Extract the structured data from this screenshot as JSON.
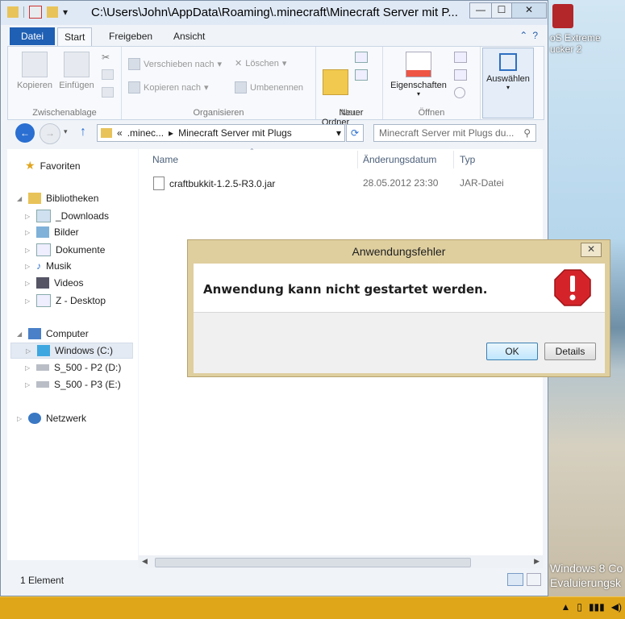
{
  "desktop": {
    "shortcut_label": "oS Extreme\nucker 2",
    "watermark": "Windows 8 Co\nEvaluierungsk"
  },
  "explorer": {
    "title": "C:\\Users\\John\\AppData\\Roaming\\.minecraft\\Minecraft Server mit P...",
    "window_buttons": {
      "minimize": "—",
      "maximize": "☐",
      "close": "✕"
    },
    "tabs": {
      "file": "Datei",
      "start": "Start",
      "share": "Freigeben",
      "view": "Ansicht"
    },
    "ribbon": {
      "clipboard": {
        "copy": "Kopieren",
        "paste": "Einfügen",
        "group": "Zwischenablage"
      },
      "organize": {
        "move_to": "Verschieben nach",
        "copy_to": "Kopieren nach",
        "delete": "Löschen",
        "rename": "Umbenennen",
        "group": "Organisieren"
      },
      "new": {
        "new_folder": "Neuer\nOrdner",
        "group": "Neu"
      },
      "open": {
        "properties": "Eigenschaften",
        "group": "Öffnen"
      },
      "select": {
        "select": "Auswählen"
      }
    },
    "address": {
      "prefix": "«",
      "segment1": ".minec...",
      "separator": "▸",
      "segment2": "Minecraft Server mit Plugs",
      "search_placeholder": "Minecraft Server mit Plugs du..."
    },
    "nav": {
      "favorites": "Favoriten",
      "libraries": "Bibliotheken",
      "downloads": "_Downloads",
      "pictures": "Bilder",
      "documents": "Dokumente",
      "music": "Musik",
      "videos": "Videos",
      "z_desktop": "Z - Desktop",
      "computer": "Computer",
      "drive_c": "Windows (C:)",
      "drive_d": "S_500 - P2 (D:)",
      "drive_e": "S_500 - P3 (E:)",
      "network": "Netzwerk"
    },
    "columns": {
      "name": "Name",
      "modified": "Änderungsdatum",
      "type": "Typ"
    },
    "files": [
      {
        "name": "craftbukkit-1.2.5-R3.0.jar",
        "modified": "28.05.2012 23:30",
        "type": "JAR-Datei"
      }
    ],
    "status": "1 Element"
  },
  "dialog": {
    "title": "Anwendungsfehler",
    "message": "Anwendung kann nicht gestartet werden.",
    "ok": "OK",
    "details": "Details",
    "close": "✕"
  },
  "colors": {
    "file_tab": "#1f5fb4",
    "dialog_frame": "#dfcf9f",
    "taskbar": "#e0a61a",
    "error_icon": "#d4242a"
  }
}
